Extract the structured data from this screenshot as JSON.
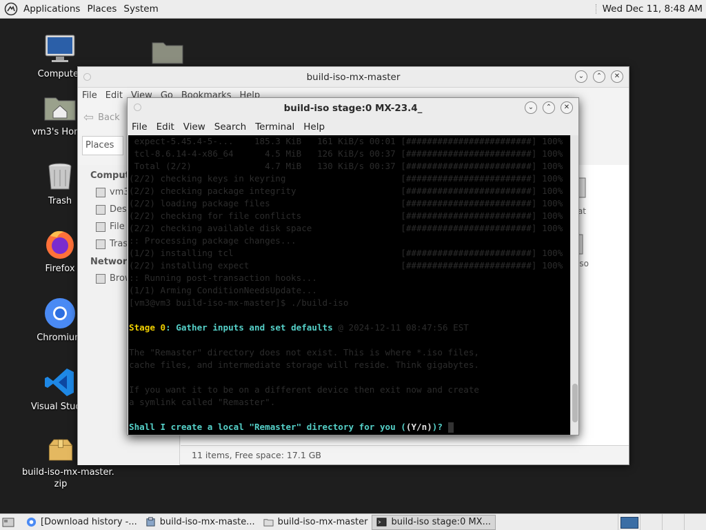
{
  "top_panel": {
    "menus": [
      "Applications",
      "Places",
      "System"
    ],
    "clock": "Wed Dec 11,  8:48 AM"
  },
  "desktop_icons": [
    {
      "label": "Computer"
    },
    {
      "label": "vm3's Home"
    },
    {
      "label": "Trash"
    },
    {
      "label": "Firefox"
    },
    {
      "label": "Chromium"
    },
    {
      "label": "Visual Studio"
    },
    {
      "label": "build-iso-mx-master.\nzip"
    }
  ],
  "file_manager": {
    "title": "build-iso-mx-master",
    "menus": [
      "File",
      "Edit",
      "View",
      "Go",
      "Bookmarks",
      "Help"
    ],
    "back_label": "Back",
    "location_select": "Places",
    "sidebar": {
      "computer_header": "Computer",
      "computer_items": [
        "vm3",
        "Desktop",
        "File System",
        "Trash"
      ],
      "network_header": "Network",
      "network_items": [
        "Browse Network"
      ]
    },
    "peek_labels": [
      "at",
      "so"
    ],
    "status": "11 items, Free space: 17.1 GB"
  },
  "terminal": {
    "title": "build-iso stage:0 MX-23.4_",
    "menus": [
      "File",
      "Edit",
      "View",
      "Search",
      "Terminal",
      "Help"
    ],
    "output_lines": [
      " expect-5.45.4-5-...    185.3 KiB   161 KiB/s 00:01 [########################] 100%",
      " tcl-8.6.14-4-x86_64      4.5 MiB   126 KiB/s 00:37 [########################] 100%",
      " Total (2/2)              4.7 MiB   130 KiB/s 00:37 [########################] 100%",
      "(2/2) checking keys in keyring                      [########################] 100%",
      "(2/2) checking package integrity                    [########################] 100%",
      "(2/2) loading package files                         [########################] 100%",
      "(2/2) checking for file conflicts                   [########################] 100%",
      "(2/2) checking available disk space                 [########################] 100%",
      ":: Processing package changes...",
      "(1/2) installing tcl                                [########################] 100%",
      "(2/2) installing expect                             [########################] 100%",
      ":: Running post-transaction hooks...",
      "(1/1) Arming ConditionNeedsUpdate...",
      "[vm3@vm3 build-iso-mx-master]$ ./build-iso",
      ""
    ],
    "stage_label": "Stage ",
    "stage_number": "0",
    "stage_title": ": Gather inputs and set defaults",
    "stage_timestamp": " @ 2024-12-11 08:47:56 EST",
    "info_lines": [
      "",
      "The \"Remaster\" directory does not exist. This is where *.iso files,",
      "cache files, and intermediate storage will reside. Think gigabytes.",
      "",
      "If you want it to be on a different device then exit now and create",
      "a symlink called \"Remaster\".",
      ""
    ],
    "prompt_text": "Shall I create a local \"Remaster\" directory for you (",
    "prompt_choice": "(Y/n)",
    "prompt_end": ")? "
  },
  "taskbar": {
    "tasks": [
      {
        "label": "[Download history -..."
      },
      {
        "label": "build-iso-mx-maste..."
      },
      {
        "label": "build-iso-mx-master"
      },
      {
        "label": "build-iso stage:0 MX..."
      }
    ]
  }
}
